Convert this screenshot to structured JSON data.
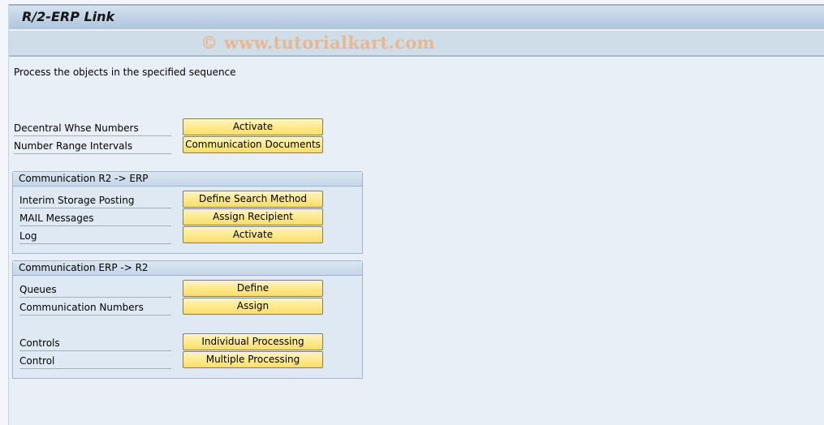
{
  "window": {
    "title": "R/2-ERP Link",
    "watermark": "© www.tutorialkart.com"
  },
  "intro_text": "Process the objects in the specified sequence",
  "top_rows": [
    {
      "label": "Decentral Whse Numbers",
      "button": "Activate"
    },
    {
      "label": "Number Range Intervals",
      "button": "Communication Documents"
    }
  ],
  "groups": [
    {
      "title": "Communication R2 -> ERP",
      "rows": [
        {
          "label": "Interim Storage Posting",
          "button": "Define Search Method"
        },
        {
          "label": "MAIL Messages",
          "button": "Assign Recipient"
        },
        {
          "label": "Log",
          "button": "Activate"
        }
      ]
    },
    {
      "title": "Communication ERP -> R2",
      "rows": [
        {
          "label": "Queues",
          "button": "Define"
        },
        {
          "label": "Communication Numbers",
          "button": "Assign"
        },
        {
          "label": "Controls",
          "button": "Individual Processing"
        },
        {
          "label": "Control",
          "button": "Multiple Processing"
        }
      ]
    }
  ],
  "colors": {
    "button_fill": "#fde989",
    "background": "#e8eff7",
    "title_bar": "#c3d4e6"
  }
}
